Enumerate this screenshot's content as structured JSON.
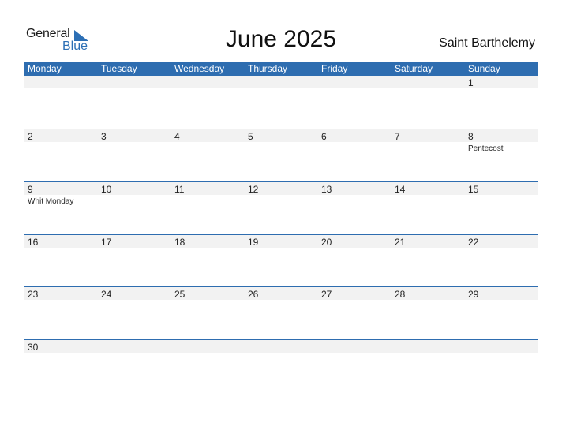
{
  "logo": {
    "line1": "General",
    "line2": "Blue",
    "icon": "triangle-flag-icon"
  },
  "header": {
    "title": "June 2025",
    "region": "Saint Barthelemy"
  },
  "colors": {
    "accent": "#2e6db0",
    "strip": "#f2f2f2",
    "logo_blue": "#2c6fb5"
  },
  "weekdays": [
    "Monday",
    "Tuesday",
    "Wednesday",
    "Thursday",
    "Friday",
    "Saturday",
    "Sunday"
  ],
  "weeks": [
    {
      "days": [
        {
          "n": ""
        },
        {
          "n": ""
        },
        {
          "n": ""
        },
        {
          "n": ""
        },
        {
          "n": ""
        },
        {
          "n": ""
        },
        {
          "n": "1"
        }
      ]
    },
    {
      "days": [
        {
          "n": "2"
        },
        {
          "n": "3"
        },
        {
          "n": "4"
        },
        {
          "n": "5"
        },
        {
          "n": "6"
        },
        {
          "n": "7"
        },
        {
          "n": "8",
          "holiday": "Pentecost"
        }
      ]
    },
    {
      "days": [
        {
          "n": "9",
          "holiday": "Whit Monday"
        },
        {
          "n": "10"
        },
        {
          "n": "11"
        },
        {
          "n": "12"
        },
        {
          "n": "13"
        },
        {
          "n": "14"
        },
        {
          "n": "15"
        }
      ]
    },
    {
      "days": [
        {
          "n": "16"
        },
        {
          "n": "17"
        },
        {
          "n": "18"
        },
        {
          "n": "19"
        },
        {
          "n": "20"
        },
        {
          "n": "21"
        },
        {
          "n": "22"
        }
      ]
    },
    {
      "days": [
        {
          "n": "23"
        },
        {
          "n": "24"
        },
        {
          "n": "25"
        },
        {
          "n": "26"
        },
        {
          "n": "27"
        },
        {
          "n": "28"
        },
        {
          "n": "29"
        }
      ]
    },
    {
      "days": [
        {
          "n": "30"
        },
        {
          "n": ""
        },
        {
          "n": ""
        },
        {
          "n": ""
        },
        {
          "n": ""
        },
        {
          "n": ""
        },
        {
          "n": ""
        }
      ]
    }
  ]
}
